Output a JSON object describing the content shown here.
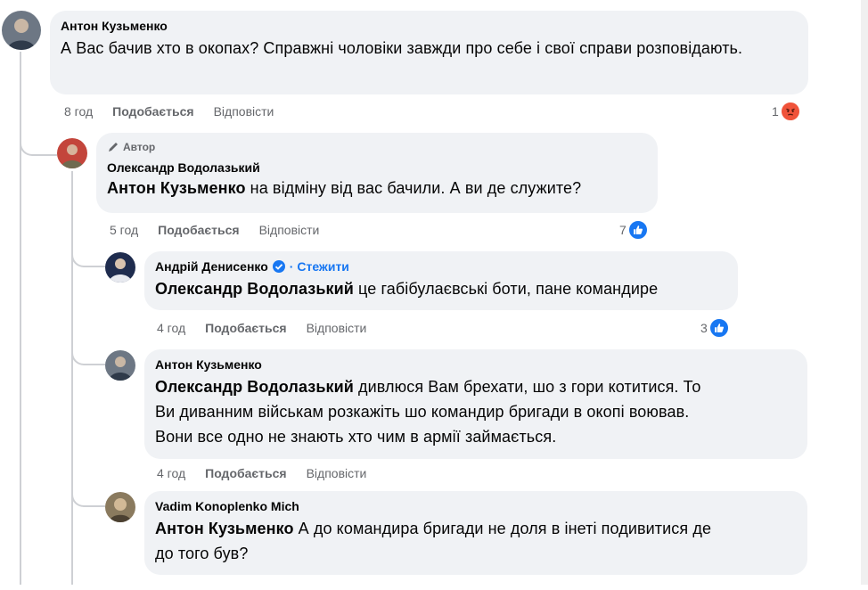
{
  "comments": [
    {
      "author": "Антон Кузьменко",
      "mention": "",
      "text": "А Вас бачив хто в окопах? Справжні чоловіки завжди про себе і свої справи розповідають.",
      "time": "8 год",
      "like_label": "Подобається",
      "reply_label": "Відповісти",
      "reaction_count": "1",
      "reaction_icon": "angry-icon",
      "reaction_color": "#f0533a"
    },
    {
      "badge": "Автор",
      "author": "Олександр Водолазький",
      "mention": "Антон Кузьменко",
      "text": " на відміну від вас бачили. А ви де служите?",
      "time": "5 год",
      "like_label": "Подобається",
      "reply_label": "Відповісти",
      "reaction_count": "7",
      "reaction_icon": "like-icon",
      "reaction_color": "#1877f2"
    },
    {
      "author": "Андрій Денисенко",
      "follow_label": "· Стежити",
      "mention": "Олександр Водолазький",
      "text": " це габібулаєвські боти, пане командире",
      "time": "4 год",
      "like_label": "Подобається",
      "reply_label": "Відповісти",
      "reaction_count": "3",
      "reaction_icon": "like-icon",
      "reaction_color": "#1877f2"
    },
    {
      "author": "Антон Кузьменко",
      "mention": "Олександр Водолазький",
      "text_line1": " дивлюся Вам брехати, шо з гори котитися. То",
      "text_line2": "Ви диванним військам розкажіть шо командир бригади в окопі воював.",
      "text_line3": "Вони все одно не знають хто чим в армії займається.",
      "time": "4 год",
      "like_label": "Подобається",
      "reply_label": "Відповісти"
    },
    {
      "author": "Vadim Konoplenko Mich",
      "mention": "Антон Кузьменко",
      "text_line1": " А до командира бригади не доля в інеті подивитися де",
      "text_line2": "до того був?"
    }
  ]
}
